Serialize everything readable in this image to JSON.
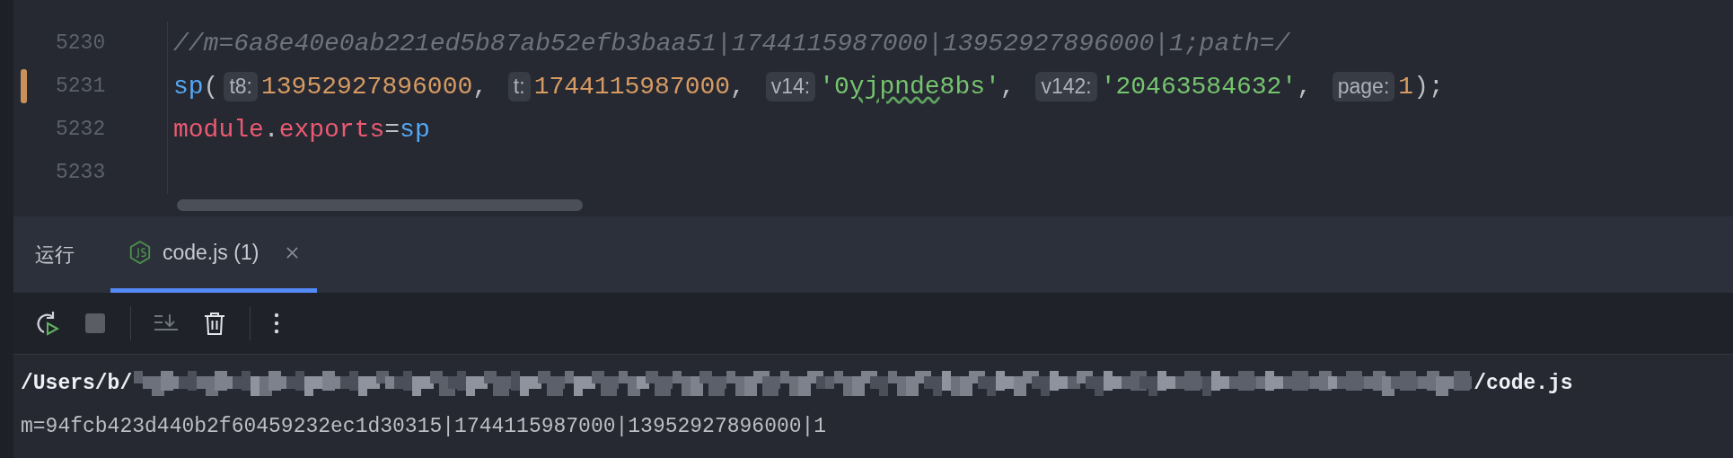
{
  "editor": {
    "lines": [
      {
        "number": "5230",
        "modified": false,
        "tokens": [
          {
            "kind": "comment",
            "text": "//m=6a8e40e0ab221ed5b87ab52efb3baa51|1744115987000|13952927896000|1;path=/"
          }
        ]
      },
      {
        "number": "5231",
        "modified": true,
        "tokens": [
          {
            "kind": "function",
            "text": "sp"
          },
          {
            "kind": "punct",
            "text": "("
          },
          {
            "kind": "hint",
            "text": "t8:"
          },
          {
            "kind": "number",
            "text": "13952927896000"
          },
          {
            "kind": "punct",
            "text": ", "
          },
          {
            "kind": "hint",
            "text": "t:"
          },
          {
            "kind": "number",
            "text": "1744115987000"
          },
          {
            "kind": "punct",
            "text": ", "
          },
          {
            "kind": "hint",
            "text": "v14:"
          },
          {
            "kind": "string",
            "text": "'0"
          },
          {
            "kind": "string",
            "text": "yjpnde",
            "typo": true
          },
          {
            "kind": "string",
            "text": "8bs'"
          },
          {
            "kind": "punct",
            "text": ", "
          },
          {
            "kind": "hint",
            "text": "v142:"
          },
          {
            "kind": "string",
            "text": "'20463584632'"
          },
          {
            "kind": "punct",
            "text": ", "
          },
          {
            "kind": "hint",
            "text": "page:"
          },
          {
            "kind": "number",
            "text": "1"
          },
          {
            "kind": "punct",
            "text": ");"
          }
        ]
      },
      {
        "number": "5232",
        "modified": false,
        "tokens": [
          {
            "kind": "keyword",
            "text": "module"
          },
          {
            "kind": "punct",
            "text": "."
          },
          {
            "kind": "keyword",
            "text": "exports"
          },
          {
            "kind": "punct",
            "text": "="
          },
          {
            "kind": "function",
            "text": "sp"
          }
        ]
      },
      {
        "number": "5233",
        "modified": false
      }
    ]
  },
  "run_panel": {
    "title": "运行",
    "tabs": [
      {
        "label": "code.js (1)",
        "selected": true
      }
    ],
    "console": [
      {
        "kind": "path",
        "prefix": "/Users/b/",
        "suffix": "/code.js"
      },
      {
        "kind": "output",
        "text": "m=94fcb423d440b2f60459232ec1d30315|1744115987000|13952927896000|1"
      }
    ]
  }
}
